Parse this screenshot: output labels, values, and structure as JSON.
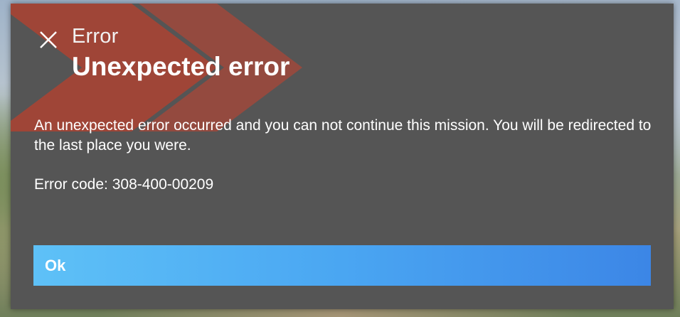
{
  "dialog": {
    "kicker": "Error",
    "title": "Unexpected error",
    "message": "An unexpected error occurred and you can not continue this mission. You will be redirected to the last place you were.",
    "error_code": "Error code: 308-400-00209",
    "ok_label": "Ok",
    "close_icon": "close-icon"
  },
  "colors": {
    "dialog_bg": "#555555",
    "accent_red": "#c8412e",
    "button_start": "#5ec1f7",
    "button_end": "#3c86e6",
    "text": "#ffffff"
  }
}
